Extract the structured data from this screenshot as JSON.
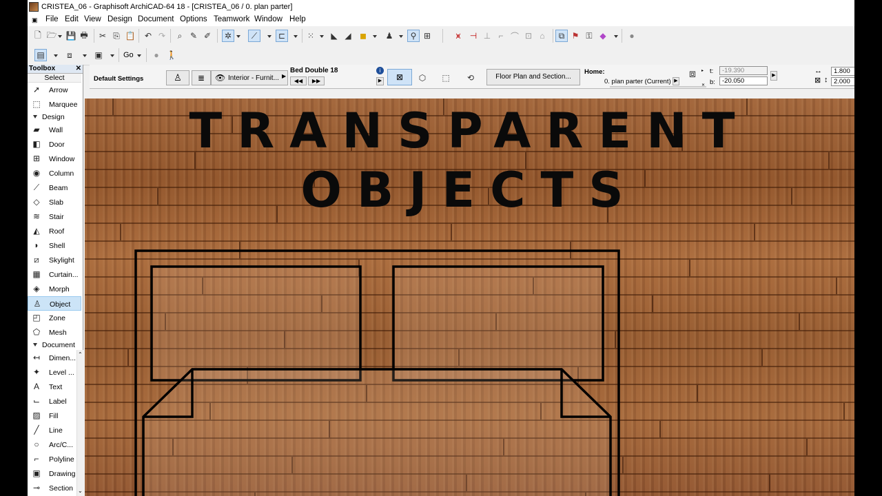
{
  "window": {
    "title": "CRISTEA_06 - Graphisoft ArchiCAD-64 18 - [CRISTEA_06 / 0. plan parter]"
  },
  "menu": [
    "File",
    "Edit",
    "View",
    "Design",
    "Document",
    "Options",
    "Teamwork",
    "Window",
    "Help"
  ],
  "toolbar2": {
    "go_label": "Go"
  },
  "toolbox": {
    "title": "Toolbox",
    "close": "✕",
    "select_label": "Select",
    "select_tools": [
      {
        "label": "Arrow",
        "icon": "arrow-icon"
      },
      {
        "label": "Marquee",
        "icon": "marquee-icon"
      }
    ],
    "design_label": "Design",
    "design_tools": [
      {
        "label": "Wall",
        "icon": "wall-icon"
      },
      {
        "label": "Door",
        "icon": "door-icon"
      },
      {
        "label": "Window",
        "icon": "window-icon"
      },
      {
        "label": "Column",
        "icon": "column-icon"
      },
      {
        "label": "Beam",
        "icon": "beam-icon"
      },
      {
        "label": "Slab",
        "icon": "slab-icon"
      },
      {
        "label": "Stair",
        "icon": "stair-icon"
      },
      {
        "label": "Roof",
        "icon": "roof-icon"
      },
      {
        "label": "Shell",
        "icon": "shell-icon"
      },
      {
        "label": "Skylight",
        "icon": "skylight-icon"
      },
      {
        "label": "Curtain...",
        "icon": "curtain-wall-icon"
      },
      {
        "label": "Morph",
        "icon": "morph-icon"
      },
      {
        "label": "Object",
        "icon": "object-icon",
        "selected": true
      },
      {
        "label": "Zone",
        "icon": "zone-icon"
      },
      {
        "label": "Mesh",
        "icon": "mesh-icon"
      }
    ],
    "document_label": "Document",
    "document_tools": [
      {
        "label": "Dimen...",
        "icon": "dimension-icon"
      },
      {
        "label": "Level ...",
        "icon": "level-dimension-icon"
      },
      {
        "label": "Text",
        "icon": "text-icon"
      },
      {
        "label": "Label",
        "icon": "label-icon"
      },
      {
        "label": "Fill",
        "icon": "fill-icon"
      },
      {
        "label": "Line",
        "icon": "line-icon"
      },
      {
        "label": "Arc/C...",
        "icon": "arc-icon"
      },
      {
        "label": "Polyline",
        "icon": "polyline-icon"
      },
      {
        "label": "Drawing",
        "icon": "drawing-icon"
      },
      {
        "label": "Section",
        "icon": "section-icon"
      }
    ]
  },
  "infobox": {
    "settings_label": "Default Settings",
    "layer": "Interior - Furnit...",
    "object_name": "Bed Double 18",
    "floorplan_button": "Floor Plan and Section...",
    "home_label": "Home:",
    "home_story": "0. plan parter (Current)",
    "t_label": "t:",
    "t_value": "-19.390",
    "b_label": "b:",
    "b_value": "-20.050",
    "width_value": "1.800",
    "height_value": "2.000"
  },
  "canvas": {
    "title_line1": "TRANSPARENT",
    "title_line2": "OBJECTS"
  },
  "colors": {
    "accent": "#cce4f7",
    "wood": "#9a5a2e",
    "outline": "#000000"
  }
}
